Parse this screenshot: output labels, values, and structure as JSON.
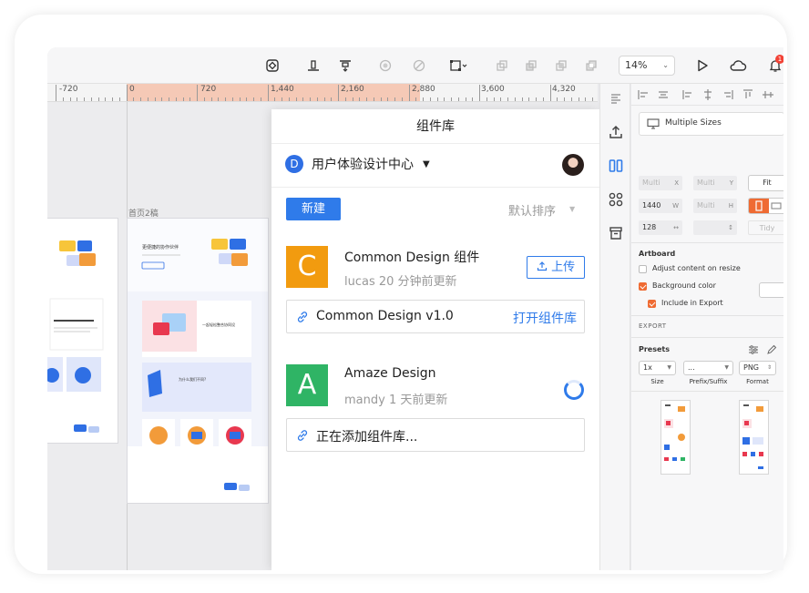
{
  "toolbar": {
    "zoom": "14%",
    "notification_count": "1"
  },
  "ruler": {
    "labels": [
      "-720",
      "0",
      "720",
      "1,440",
      "2,160",
      "2,880",
      "3,600",
      "4,320"
    ]
  },
  "canvas": {
    "artboard_label": "首页2稿",
    "artboard_headline": "更便捷的协作伙伴",
    "artboard_section1": "一起轻松整合协同设",
    "artboard_section2": "为什么我们不同?"
  },
  "library": {
    "title": "组件库",
    "team_initial": "D",
    "team_name": "用户体验设计中心",
    "new_button": "新建",
    "sort_label": "默认排序",
    "items": [
      {
        "initial": "C",
        "name": "Common Design 组件",
        "meta": "lucas 20 分钟前更新",
        "color": "#f29b0f",
        "action": "上传",
        "link_text": "Common Design v1.0",
        "link_action": "打开组件库"
      },
      {
        "initial": "A",
        "name": "Amaze Design",
        "meta": "mandy 1 天前更新",
        "color": "#2fb465",
        "link_text": "正在添加组件库..."
      }
    ]
  },
  "inspector": {
    "preset_label": "Multiple Sizes",
    "x_placeholder": "Multi",
    "x_suffix": "X",
    "y_placeholder": "Multi",
    "y_suffix": "Y",
    "fit_button": "Fit",
    "width": "1440",
    "width_suffix": "W",
    "height_placeholder": "Multi",
    "height_suffix": "H",
    "rotation": "128",
    "tidy": "Tidy",
    "artboard_title": "Artboard",
    "adjust_label": "Adjust content on resize",
    "bg_label": "Background color",
    "include_label": "Include in Export",
    "export_caption": "EXPORT",
    "presets_title": "Presets",
    "scale": "1x",
    "prefix": "...",
    "format": "PNG",
    "size_caption": "Size",
    "prefix_caption": "Prefix/Suffix",
    "format_caption": "Format",
    "accent": "#ef6b33"
  }
}
